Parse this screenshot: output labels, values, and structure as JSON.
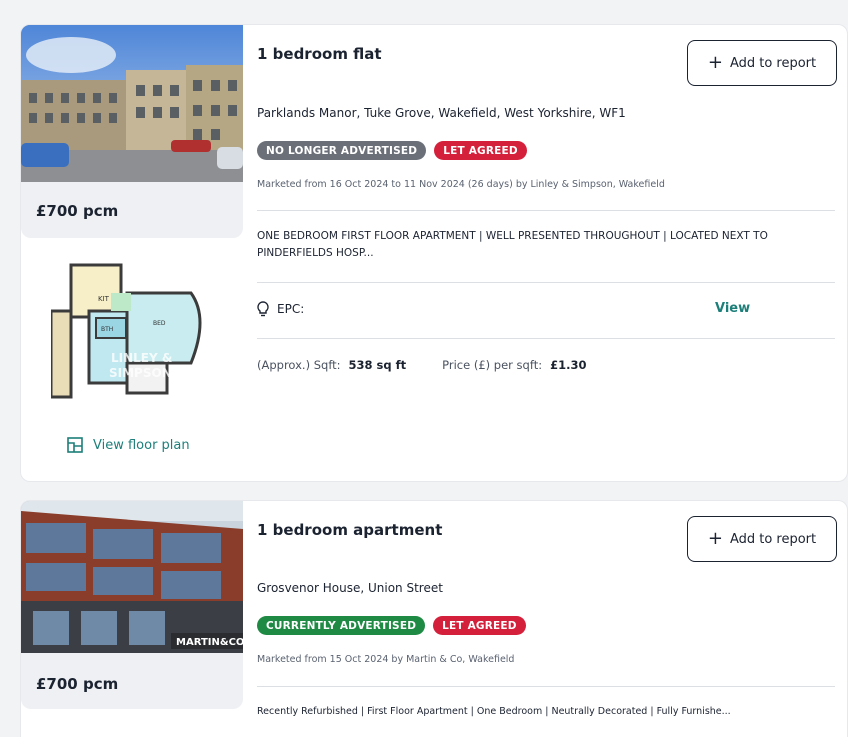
{
  "listings": [
    {
      "title": "1 bedroom flat",
      "add_button_label": "Add to report",
      "address": "Parklands Manor, Tuke Grove, Wakefield, West Yorkshire, WF1",
      "badges": [
        "NO LONGER ADVERTISED",
        "LET AGREED"
      ],
      "marketed": "Marketed from 16 Oct 2024 to 11 Nov 2024 (26 days) by Linley & Simpson, Wakefield",
      "description": "ONE BEDROOM FIRST FLOOR APARTMENT | WELL PRESENTED THROUGHOUT | LOCATED NEXT TO PINDERFIELDS HOSP...",
      "epc_label": "EPC:",
      "epc_view": "View",
      "sqft_label": "(Approx.) Sqft:",
      "sqft_value": "538 sq ft",
      "price_per_sqft_label": "Price (£) per sqft:",
      "price_per_sqft_value": "£1.30",
      "price": "£700 pcm",
      "floor_plan_link": "View floor plan",
      "floor_plan_watermark": "LINLEY & SIMPSON"
    },
    {
      "title": "1 bedroom apartment",
      "add_button_label": "Add to report",
      "address": "Grosvenor House, Union Street",
      "badges": [
        "CURRENTLY ADVERTISED",
        "LET AGREED"
      ],
      "marketed": "Marketed from 15 Oct 2024 by Martin & Co, Wakefield",
      "description": "Recently Refurbished | First Floor Apartment | One Bedroom | Neutrally Decorated | Fully Furnishe...",
      "price": "£700 pcm",
      "photo_watermark": "MARTIN&CO"
    }
  ],
  "icons": {
    "plus": "plus-icon",
    "epc": "lightbulb-icon",
    "floor_plan": "floor-plan-icon"
  },
  "colors": {
    "accent_teal": "#1d7f7a",
    "badge_grey": "#6b7078",
    "badge_red": "#d4203b",
    "badge_green": "#1e8a44"
  }
}
